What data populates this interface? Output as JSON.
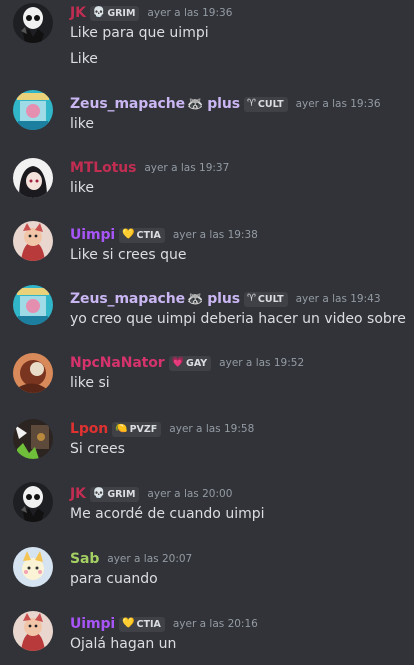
{
  "colors": {
    "background": "#313338",
    "text": "#dbdee1",
    "timestamp": "#949ba4",
    "badge_bg": "#3f4147"
  },
  "messages": [
    {
      "author": "JK",
      "author_color": "#c22d52",
      "badge": {
        "icon": "skull-icon",
        "glyph": "💀",
        "label": "GRIM"
      },
      "timestamp": "ayer a las 19:36",
      "lines": [
        "Like para que uimpi",
        "Like"
      ],
      "avatar": "skull-avatar"
    },
    {
      "author": "Zeus_mapache",
      "author_color": "#c9b6f2",
      "author_suffix": "plus",
      "author_emoji": "🦝",
      "badge": {
        "icon": "cult-goat-icon",
        "glyph": "♈",
        "label": "CULT"
      },
      "timestamp": "ayer a las 19:36",
      "lines": [
        "like"
      ],
      "avatar": "arcade-avatar"
    },
    {
      "author": "MTLotus",
      "author_color": "#c22d52",
      "timestamp": "ayer a las 19:37",
      "lines": [
        "like"
      ],
      "avatar": "anime-girl-avatar"
    },
    {
      "author": "Uimpi",
      "author_color": "#a855f7",
      "badge": {
        "icon": "yellow-heart-icon",
        "glyph": "💛",
        "label": "CTIA"
      },
      "timestamp": "ayer a las 19:38",
      "lines": [
        "Like si crees que"
      ],
      "avatar": "cartoon-creature-avatar"
    },
    {
      "author": "Zeus_mapache",
      "author_color": "#c9b6f2",
      "author_suffix": "plus",
      "author_emoji": "🦝",
      "badge": {
        "icon": "cult-goat-icon",
        "glyph": "♈",
        "label": "CULT"
      },
      "timestamp": "ayer a las 19:43",
      "lines": [
        "yo creo que uimpi deberia hacer un video sobre"
      ],
      "avatar": "arcade-avatar"
    },
    {
      "author": "NpcNaNator",
      "author_color": "#d6336c",
      "badge": {
        "icon": "pink-heart-icon",
        "glyph": "💗",
        "label": "GAY"
      },
      "timestamp": "ayer a las 19:52",
      "lines": [
        "like si"
      ],
      "avatar": "orange-creature-avatar"
    },
    {
      "author": "Lpon",
      "author_color": "#e03131",
      "badge": {
        "icon": "lemon-icon",
        "glyph": "🍋",
        "label": "PVZF"
      },
      "timestamp": "ayer a las 19:58",
      "lines": [
        "Si crees"
      ],
      "avatar": "dark-scene-avatar"
    },
    {
      "author": "JK",
      "author_color": "#c22d52",
      "badge": {
        "icon": "skull-icon",
        "glyph": "💀",
        "label": "GRIM"
      },
      "timestamp": "ayer a las 20:00",
      "lines": [
        "Me acordé de cuando uimpi"
      ],
      "avatar": "skull-avatar"
    },
    {
      "author": "Sab",
      "author_color": "#a3cf63",
      "timestamp": "ayer a las 20:07",
      "lines": [
        "para cuando"
      ],
      "avatar": "pastel-character-avatar"
    },
    {
      "author": "Uimpi",
      "author_color": "#a855f7",
      "badge": {
        "icon": "yellow-heart-icon",
        "glyph": "💛",
        "label": "CTIA"
      },
      "timestamp": "ayer a las 20:16",
      "lines": [
        "Ojalá  hagan un"
      ],
      "avatar": "cartoon-creature-avatar"
    }
  ]
}
